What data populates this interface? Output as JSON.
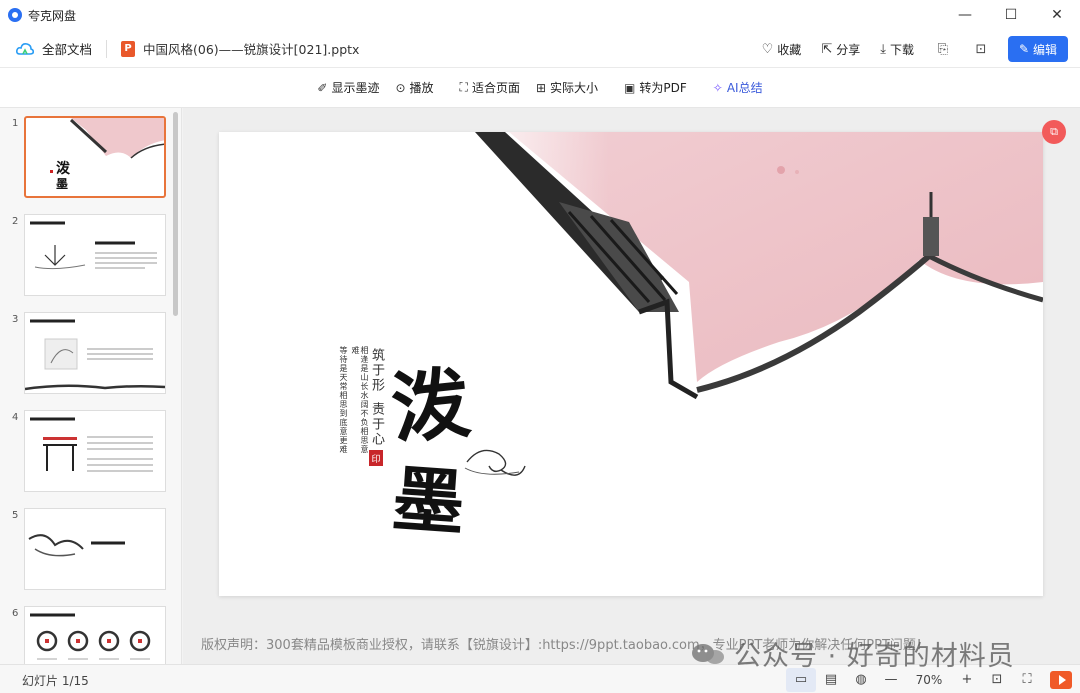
{
  "window": {
    "app_title": "夸克网盘",
    "minimize": "—",
    "maximize": "☐",
    "close": "✕"
  },
  "header": {
    "all_docs": "全部文档",
    "doc_title": "中国风格(06)——锐旗设计[021].pptx",
    "ppt_badge": "P",
    "favorite": "收藏",
    "share": "分享",
    "download": "下载",
    "edit": "编辑"
  },
  "toolbar": {
    "show_ink": "显示墨迹",
    "play": "播放",
    "fit_page": "适合页面",
    "actual_size": "实际大小",
    "to_pdf": "转为PDF",
    "ai_summary": "AI总结"
  },
  "sidebar": {
    "thumbnails": [
      {
        "num": "1"
      },
      {
        "num": "2"
      },
      {
        "num": "3"
      },
      {
        "num": "4"
      },
      {
        "num": "5"
      },
      {
        "num": "6"
      }
    ]
  },
  "slide": {
    "title_chars": [
      "泼",
      "墨"
    ],
    "subtitle_left": "筑于形",
    "subtitle_right": "责于心",
    "seal": "印",
    "poem_col1": "等待是天常相思到底意更难",
    "poem_col2": "相逢是山长水阔不负相思意难"
  },
  "footer": {
    "copyright": "版权声明：300套精品模板商业授权，请联系【锐旗设计】:https://9ppt.taobao.com，专业PPT老师为你解决任何PPT问题！"
  },
  "statusbar": {
    "slide_count": "幻灯片 1/15",
    "zoom": "70%"
  },
  "watermark": {
    "text": "公众号 · 好奇的材料员"
  },
  "colors": {
    "accent": "#2a6ff2",
    "ppt_orange": "#e9582b",
    "fab_red": "#f25a5a",
    "slide_pink": "#efc8cc"
  }
}
